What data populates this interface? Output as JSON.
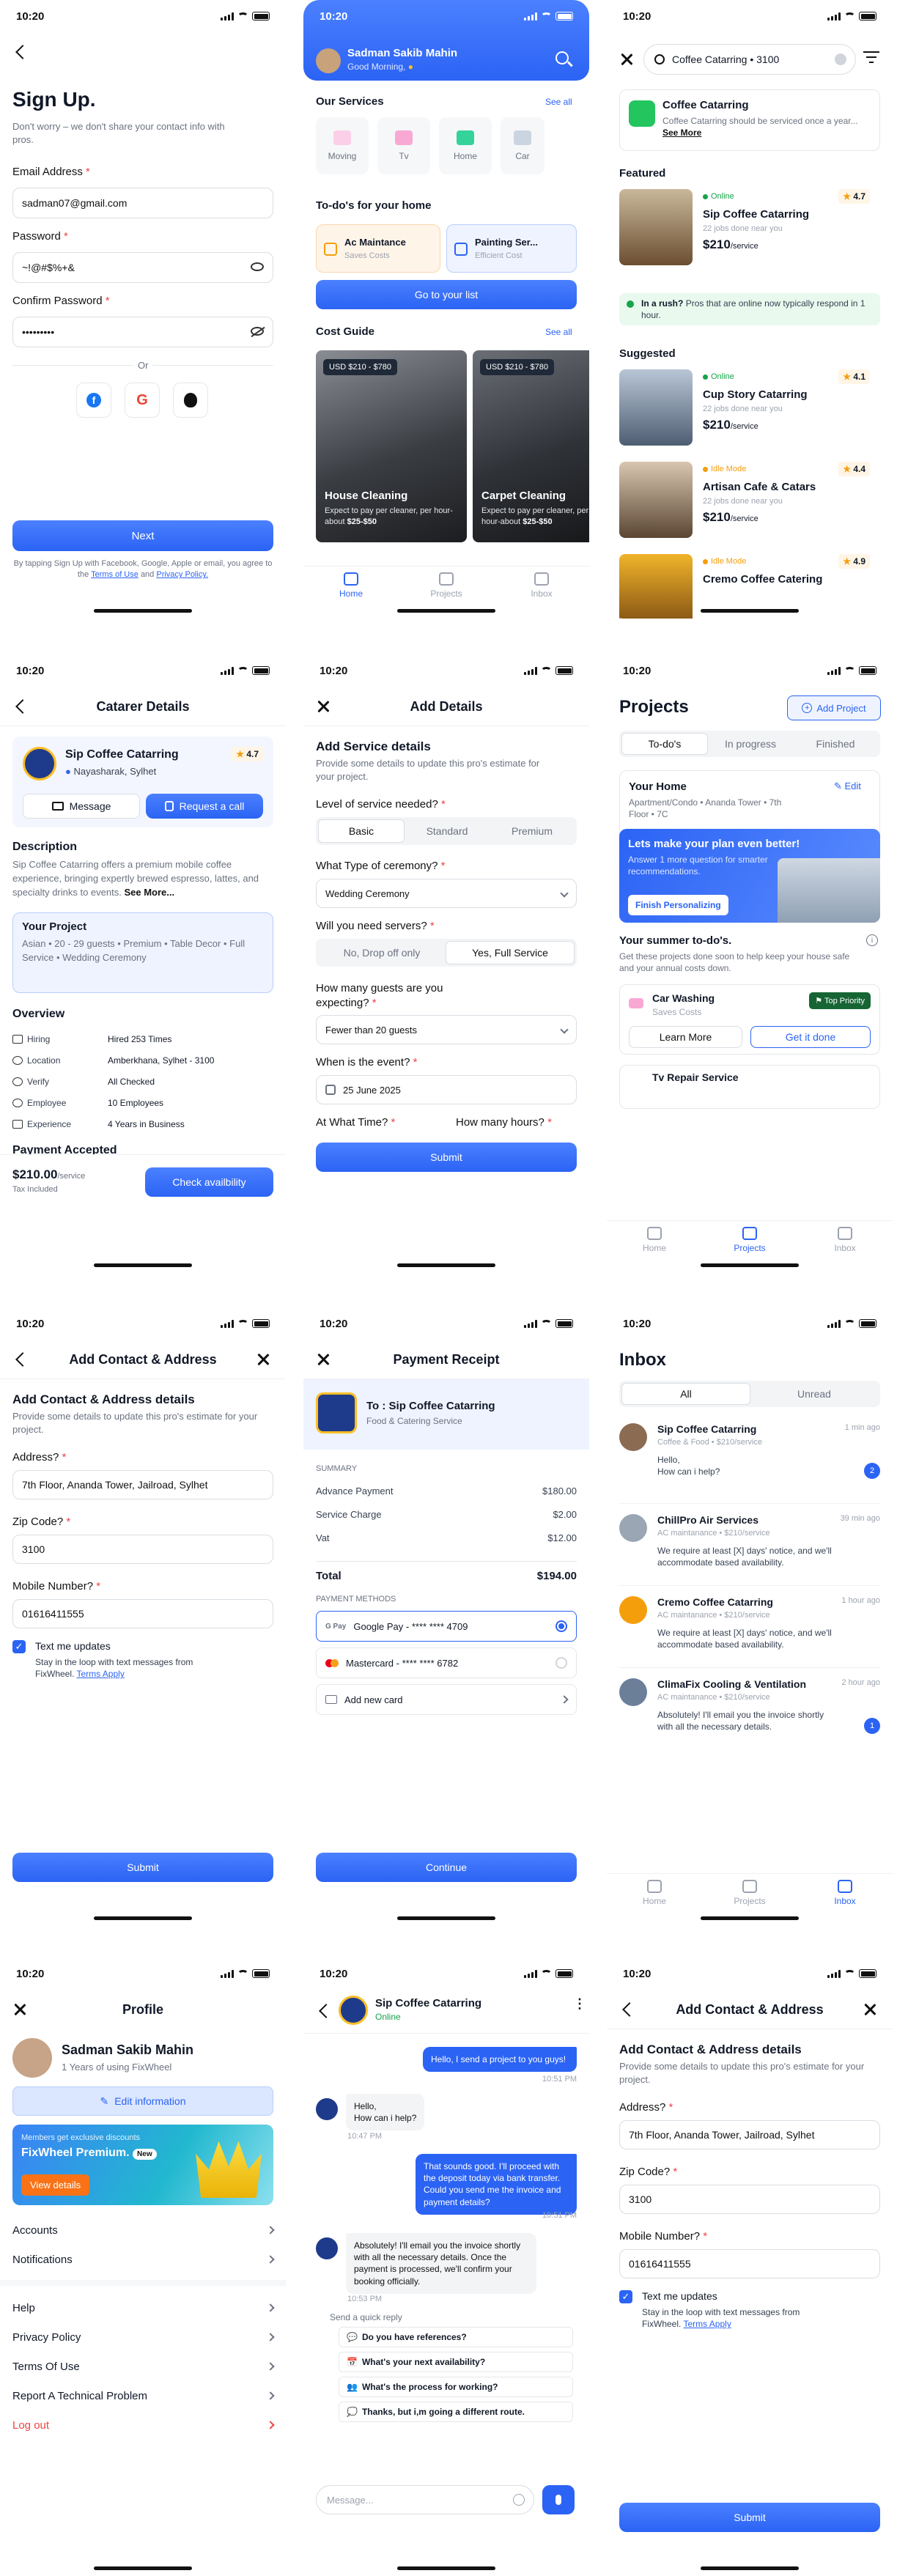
{
  "status_time": "10:20",
  "signup": {
    "title": "Sign Up.",
    "subtitle": "Don't worry – we don't share your contact info with pros.",
    "email_label": "Email Address",
    "email_value": "sadman07@gmail.com",
    "password_label": "Password",
    "password_value": "~!@#$%+&",
    "confirm_label": "Confirm Password",
    "confirm_value": "•••••••••",
    "or": "Or",
    "next": "Next",
    "terms_prefix": "By tapping Sign Up with Facebook, Google, Apple or email, you agree to the",
    "terms_link": "Terms of Use",
    "and": "and",
    "privacy_link": "Privacy Policy."
  },
  "home": {
    "user_name": "Sadman Sakib Mahin",
    "greeting": "Good Morning,",
    "services_title": "Our Services",
    "see_all": "See all",
    "services": [
      "Moving",
      "Tv",
      "Home",
      "Car"
    ],
    "todo_title": "To-do's for your home",
    "todo": [
      {
        "title": "Ac Maintance",
        "sub": "Saves Costs"
      },
      {
        "title": "Painting Ser...",
        "sub": "Efficient Cost"
      }
    ],
    "go_list": "Go to your list",
    "cost_title": "Cost Guide",
    "costs": [
      {
        "badge": "USD $210 - $780",
        "title": "House Cleaning",
        "desc": "Expect to pay per cleaner, per hour-about",
        "price": "$25-$50"
      },
      {
        "badge": "USD $210 - $780",
        "title": "Carpet Cleaning",
        "desc": "Expect to pay per cleaner, per hour-about",
        "price": "$25-$50"
      }
    ],
    "tabs": [
      "Home",
      "Projects",
      "Inbox"
    ]
  },
  "search": {
    "query": "Coffee Catarring • 3100",
    "service_title": "Coffee Catarring",
    "service_desc": "Coffee Catarring should be serviced once a year...",
    "see_more": "See More",
    "featured": "Featured",
    "suggested": "Suggested",
    "rush_bold": "In a rush?",
    "rush_text": "Pros that are online now typically respond in 1 hour.",
    "per": "/service",
    "listings": [
      {
        "status": "Online",
        "name": "Sip Coffee Catarring",
        "jobs": "22 jobs done near you",
        "price": "$210",
        "rating": "4.7"
      },
      {
        "status": "Online",
        "name": "Cup Story Catarring",
        "jobs": "22 jobs done near you",
        "price": "$210",
        "rating": "4.1"
      },
      {
        "status": "Idle Mode",
        "name": "Artisan Cafe & Catars",
        "jobs": "22 jobs done near you",
        "price": "$210",
        "rating": "4.4"
      },
      {
        "status": "Idle Mode",
        "name": "Cremo Coffee Catering",
        "rating": "4.9"
      }
    ]
  },
  "details": {
    "title": "Catarer Details",
    "name": "Sip Coffee Catarring",
    "location": "Nayasharak, Sylhet",
    "rating": "4.7",
    "message": "Message",
    "request": "Request a call",
    "desc_title": "Description",
    "desc": "Sip Coffee Catarring offers a premium mobile coffee experience, bringing expertly brewed espresso, lattes, and specialty drinks to events.",
    "see_more": "See More...",
    "proj_title": "Your Project",
    "proj_desc": "Asian • 20 - 29 guests • Premium • Table Decor • Full Service • Wedding Ceremony",
    "overview": "Overview",
    "rows": [
      {
        "k": "Hiring",
        "v": "Hired 253 Times"
      },
      {
        "k": "Location",
        "v": "Amberkhana, Sylhet - 3100"
      },
      {
        "k": "Verify",
        "v": "All Checked"
      },
      {
        "k": "Employee",
        "v": "10 Employees"
      },
      {
        "k": "Experience",
        "v": "4 Years in Business"
      }
    ],
    "payment": "Payment Accepted",
    "price": "$210.00",
    "per": "/service",
    "tax": "Tax Included",
    "check": "Check availbility"
  },
  "adddetails": {
    "title": "Add Details",
    "h": "Add Service details",
    "sub": "Provide some details to update this pro's estimate for your project.",
    "q1": "Level of service needed?",
    "levels": [
      "Basic",
      "Standard",
      "Premium"
    ],
    "q2": "What Type of ceremony?",
    "ceremony": "Wedding Ceremony",
    "q3": "Will you need servers?",
    "servers": [
      "No, Drop off only",
      "Yes, Full Service"
    ],
    "q4": "How many guests are you expecting?",
    "guests": "Fewer than 20 guests",
    "q5": "When is the event?",
    "date": "25 June 2025",
    "q6": "At What Time?",
    "q7": "How many hours?",
    "submit": "Submit"
  },
  "projects": {
    "title": "Projects",
    "add": "Add Project",
    "tabs": [
      "To-do's",
      "In progress",
      "Finished"
    ],
    "home": "Your Home",
    "edit": "Edit",
    "address": "Apartment/Condo • Ananda Tower • 7th Floor • 7C",
    "banner_title": "Lets make your plan even better!",
    "banner_text": "Answer 1 more question for smarter recommendations.",
    "finish": "Finish Personalizing",
    "summer": "Your summer to-do's.",
    "summer_text": "Get these projects done soon to help keep your house safe and your annual costs down.",
    "task": "Car Washing",
    "task_sub": "Saves Costs",
    "priority": "Top Priority",
    "learn": "Learn More",
    "done": "Get it done",
    "next_task": "Tv Repair Service",
    "tabbar": [
      "Home",
      "Projects",
      "Inbox"
    ]
  },
  "contact": {
    "title": "Add Contact & Address",
    "h": "Add Contact & Address details",
    "sub": "Provide some details to update this pro's estimate for your project.",
    "addr_label": "Address?",
    "addr": "7th Floor, Ananda Tower, Jailroad, Sylhet",
    "zip_label": "Zip Code?",
    "zip": "3100",
    "mob_label": "Mobile Number?",
    "mob": "01616411555",
    "text_me": "Text me updates",
    "stay": "Stay in the loop with text messages from FixWheel.",
    "terms": "Terms Apply",
    "submit": "Submit"
  },
  "receipt": {
    "title": "Payment Receipt",
    "to": "To : Sip Coffee Catarring",
    "cat": "Food & Catering Service",
    "summary": "SUMMARY",
    "lines": [
      {
        "k": "Advance Payment",
        "v": "$180.00"
      },
      {
        "k": "Service Charge",
        "v": "$2.00"
      },
      {
        "k": "Vat",
        "v": "$12.00"
      }
    ],
    "total_k": "Total",
    "total_v": "$194.00",
    "methods": "PAYMENT METHODS",
    "cards": [
      "Google Pay - **** **** 4709",
      "Mastercard - **** **** 6782"
    ],
    "add_card": "Add new card",
    "continue": "Continue"
  },
  "inbox": {
    "title": "Inbox",
    "tabs": [
      "All",
      "Unread"
    ],
    "msgs": [
      {
        "name": "Sip Coffee Catarring",
        "sub": "Coffee & Food • $210/service",
        "time": "1 min ago",
        "text": "Hello,\nHow can i help?",
        "badge": "2"
      },
      {
        "name": "ChillPro Air Services",
        "sub": "AC maintanance • $210/service",
        "time": "39 min ago",
        "text": "We require at least [X] days' notice, and we'll accommodate based availability.",
        "badge": ""
      },
      {
        "name": "Cremo Coffee Catarring",
        "sub": "AC maintanance • $210/service",
        "time": "1 hour ago",
        "text": "We require at least [X] days' notice, and we'll accommodate based availability.",
        "badge": ""
      },
      {
        "name": "ClimaFix Cooling & Ventilation",
        "sub": "AC maintanance • $210/service",
        "time": "2 hour ago",
        "text": "Absolutely! I'll email you the invoice shortly with all the necessary details.",
        "badge": "1"
      }
    ],
    "tabbar": [
      "Home",
      "Projects",
      "Inbox"
    ]
  },
  "profile": {
    "title": "Profile",
    "name": "Sadman Sakib Mahin",
    "since": "1 Years of using FixWheel",
    "edit": "Edit information",
    "promo_small": "Members get exclusive discounts",
    "promo_title": "FixWheel Premium.",
    "promo_new": "New",
    "view": "View details",
    "menu1": [
      "Accounts",
      "Notifications"
    ],
    "menu2": [
      "Help",
      "Privacy Policy",
      "Terms Of Use",
      "Report A Technical Problem"
    ],
    "logout": "Log out"
  },
  "chat": {
    "name": "Sip Coffee Catarring",
    "status": "Online",
    "m1": "Hello, I send a project to you guys!",
    "t1": "10:51 PM",
    "m2": "Hello,\nHow can i help?",
    "t2": "10:47 PM",
    "m3": "That sounds good. I'll proceed with the deposit today via bank transfer. Could you send me the invoice and payment details?",
    "t3": "10:51 PM",
    "m4": "Absolutely! I'll email you the invoice shortly with all the necessary details. Once the payment is processed, we'll confirm your booking officially.",
    "t4": "10:53 PM",
    "quick": "Send a quick reply",
    "replies": [
      "Do you have references?",
      "What's your next availability?",
      "What's the process for working?",
      "Thanks, but i,m going a different route."
    ],
    "placeholder": "Message..."
  },
  "colors": {
    "primary": "#2b63f4",
    "bg_light": "#eef3ff",
    "green": "#16a34a",
    "orange": "#f59e0b",
    "red": "#ef4444"
  }
}
